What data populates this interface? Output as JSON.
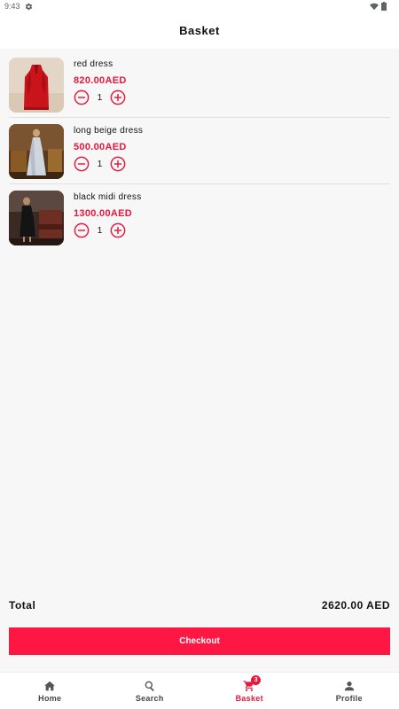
{
  "status_bar": {
    "time": "9:43",
    "settings_icon": "gear-icon",
    "wifi_icon": "wifi-icon",
    "battery_icon": "battery-icon"
  },
  "header": {
    "title": "Basket"
  },
  "items": [
    {
      "name": "red dress",
      "price": "820.00AED",
      "quantity": "1",
      "image_icon": "red-dress-photo"
    },
    {
      "name": "long beige dress",
      "price": "500.00AED",
      "quantity": "1",
      "image_icon": "beige-dress-photo"
    },
    {
      "name": "black midi dress",
      "price": "1300.00AED",
      "quantity": "1",
      "image_icon": "black-dress-photo"
    }
  ],
  "summary": {
    "total_label": "Total",
    "total_value": "2620.00 AED"
  },
  "checkout": {
    "label": "Checkout"
  },
  "bottom_nav": {
    "items": [
      {
        "label": "Home",
        "icon": "home-icon"
      },
      {
        "label": "Search",
        "icon": "search-icon"
      },
      {
        "label": "Basket",
        "icon": "cart-icon",
        "badge": "3",
        "active": true
      },
      {
        "label": "Profile",
        "icon": "person-icon"
      }
    ]
  },
  "colors": {
    "accent": "#e8173d",
    "checkout_button": "#ff1744",
    "background": "#f7f7f7"
  }
}
